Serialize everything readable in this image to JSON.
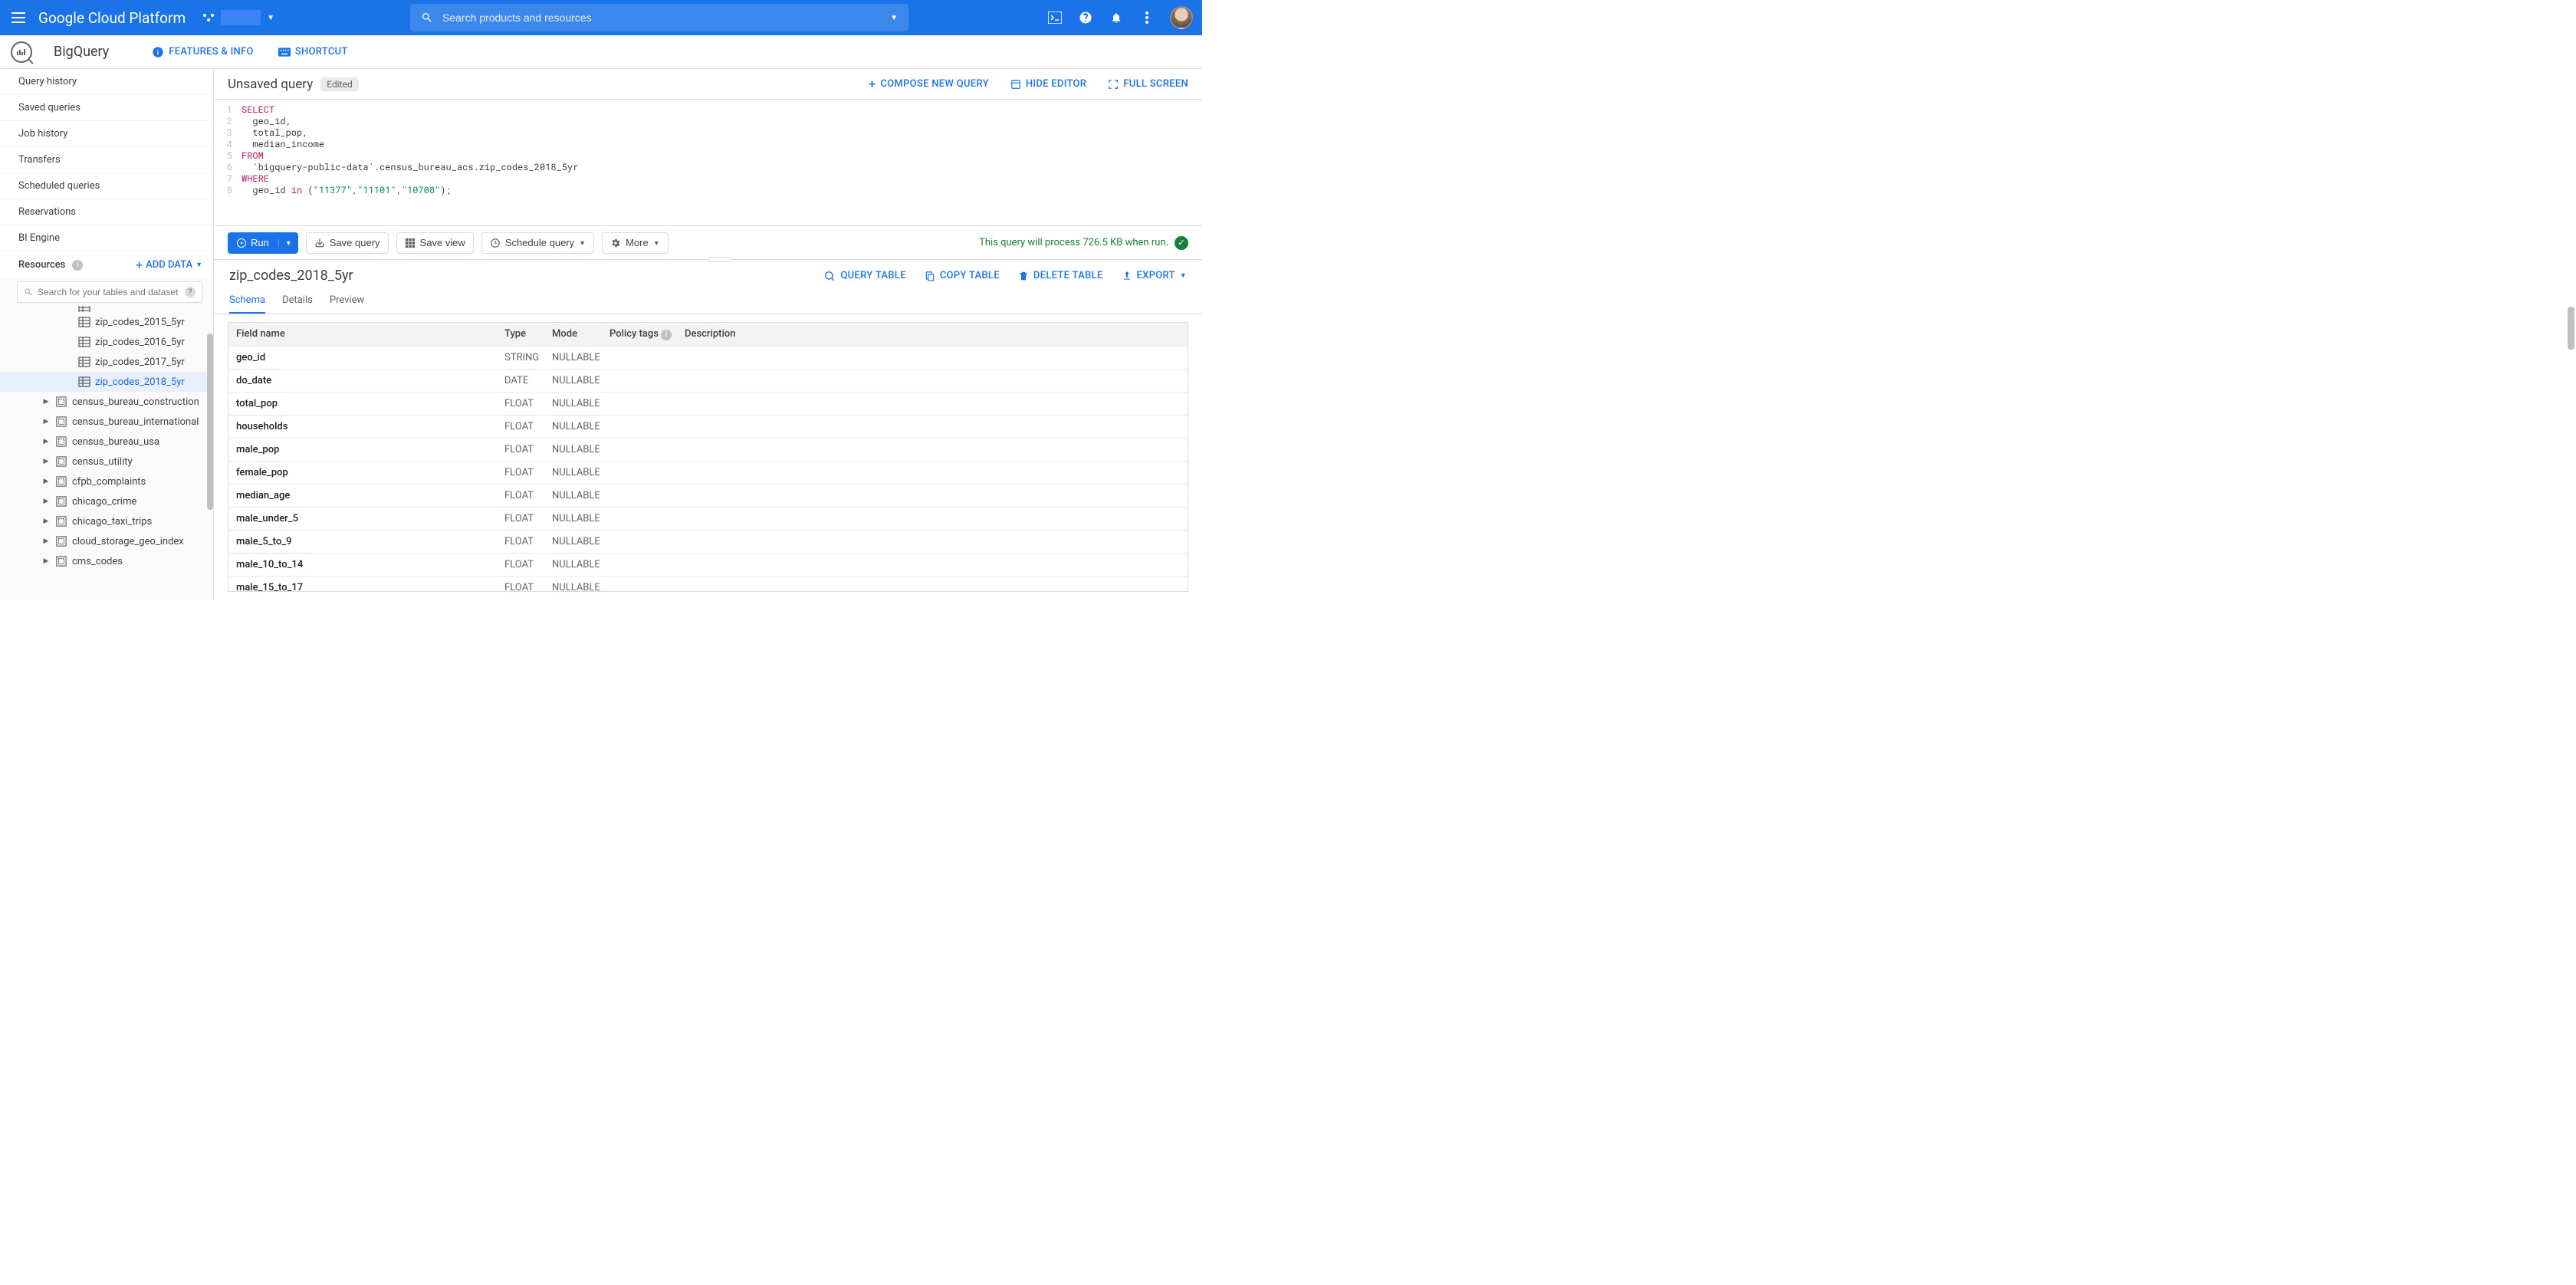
{
  "header": {
    "title": "Google Cloud Platform",
    "search_placeholder": "Search products and resources"
  },
  "product": {
    "name": "BigQuery",
    "features_label": "FEATURES & INFO",
    "shortcut_label": "SHORTCUT"
  },
  "sidebar": {
    "nav": [
      "Query history",
      "Saved queries",
      "Job history",
      "Transfers",
      "Scheduled queries",
      "Reservations",
      "BI Engine"
    ],
    "resources_label": "Resources",
    "add_data_label": "ADD DATA",
    "search_placeholder": "Search for your tables and datasets",
    "tables": [
      "zip_codes_2015_5yr",
      "zip_codes_2016_5yr",
      "zip_codes_2017_5yr",
      "zip_codes_2018_5yr"
    ],
    "selected_table_index": 3,
    "datasets": [
      "census_bureau_construction",
      "census_bureau_international",
      "census_bureau_usa",
      "census_utility",
      "cfpb_complaints",
      "chicago_crime",
      "chicago_taxi_trips",
      "cloud_storage_geo_index",
      "cms_codes"
    ]
  },
  "query": {
    "title": "Unsaved query",
    "edited_badge": "Edited",
    "compose_label": "COMPOSE NEW QUERY",
    "hide_editor_label": "HIDE EDITOR",
    "full_screen_label": "FULL SCREEN",
    "lines": [
      "1",
      "2",
      "3",
      "4",
      "5",
      "6",
      "7",
      "8"
    ]
  },
  "sql": {
    "l1_kw": "SELECT",
    "l2": "  geo_id,",
    "l3": "  total_pop,",
    "l4": "  median_income",
    "l5_kw": "FROM",
    "l6": "  `bigquery-public-data`.census_bureau_acs.zip_codes_2018_5yr",
    "l7_kw": "WHERE",
    "l8a": "  geo_id ",
    "l8_in": "in",
    "l8b": " (",
    "l8s1": "\"11377\"",
    "l8c": ",",
    "l8s2": "\"11101\"",
    "l8s3": "\"10708\"",
    "l8d": ");"
  },
  "toolbar": {
    "run_label": "Run",
    "save_query_label": "Save query",
    "save_view_label": "Save view",
    "schedule_label": "Schedule query",
    "more_label": "More",
    "process_msg": "This query will process 726.5 KB when run."
  },
  "detail": {
    "table_name": "zip_codes_2018_5yr",
    "query_table_label": "QUERY TABLE",
    "copy_table_label": "COPY TABLE",
    "delete_table_label": "DELETE TABLE",
    "export_label": "EXPORT",
    "tabs": [
      "Schema",
      "Details",
      "Preview"
    ],
    "active_tab": 0,
    "schema_headers": {
      "field": "Field name",
      "type": "Type",
      "mode": "Mode",
      "policy": "Policy tags",
      "desc": "Description"
    },
    "schema": [
      {
        "name": "geo_id",
        "type": "STRING",
        "mode": "NULLABLE"
      },
      {
        "name": "do_date",
        "type": "DATE",
        "mode": "NULLABLE"
      },
      {
        "name": "total_pop",
        "type": "FLOAT",
        "mode": "NULLABLE"
      },
      {
        "name": "households",
        "type": "FLOAT",
        "mode": "NULLABLE"
      },
      {
        "name": "male_pop",
        "type": "FLOAT",
        "mode": "NULLABLE"
      },
      {
        "name": "female_pop",
        "type": "FLOAT",
        "mode": "NULLABLE"
      },
      {
        "name": "median_age",
        "type": "FLOAT",
        "mode": "NULLABLE"
      },
      {
        "name": "male_under_5",
        "type": "FLOAT",
        "mode": "NULLABLE"
      },
      {
        "name": "male_5_to_9",
        "type": "FLOAT",
        "mode": "NULLABLE"
      },
      {
        "name": "male_10_to_14",
        "type": "FLOAT",
        "mode": "NULLABLE"
      },
      {
        "name": "male_15_to_17",
        "type": "FLOAT",
        "mode": "NULLABLE"
      }
    ]
  }
}
